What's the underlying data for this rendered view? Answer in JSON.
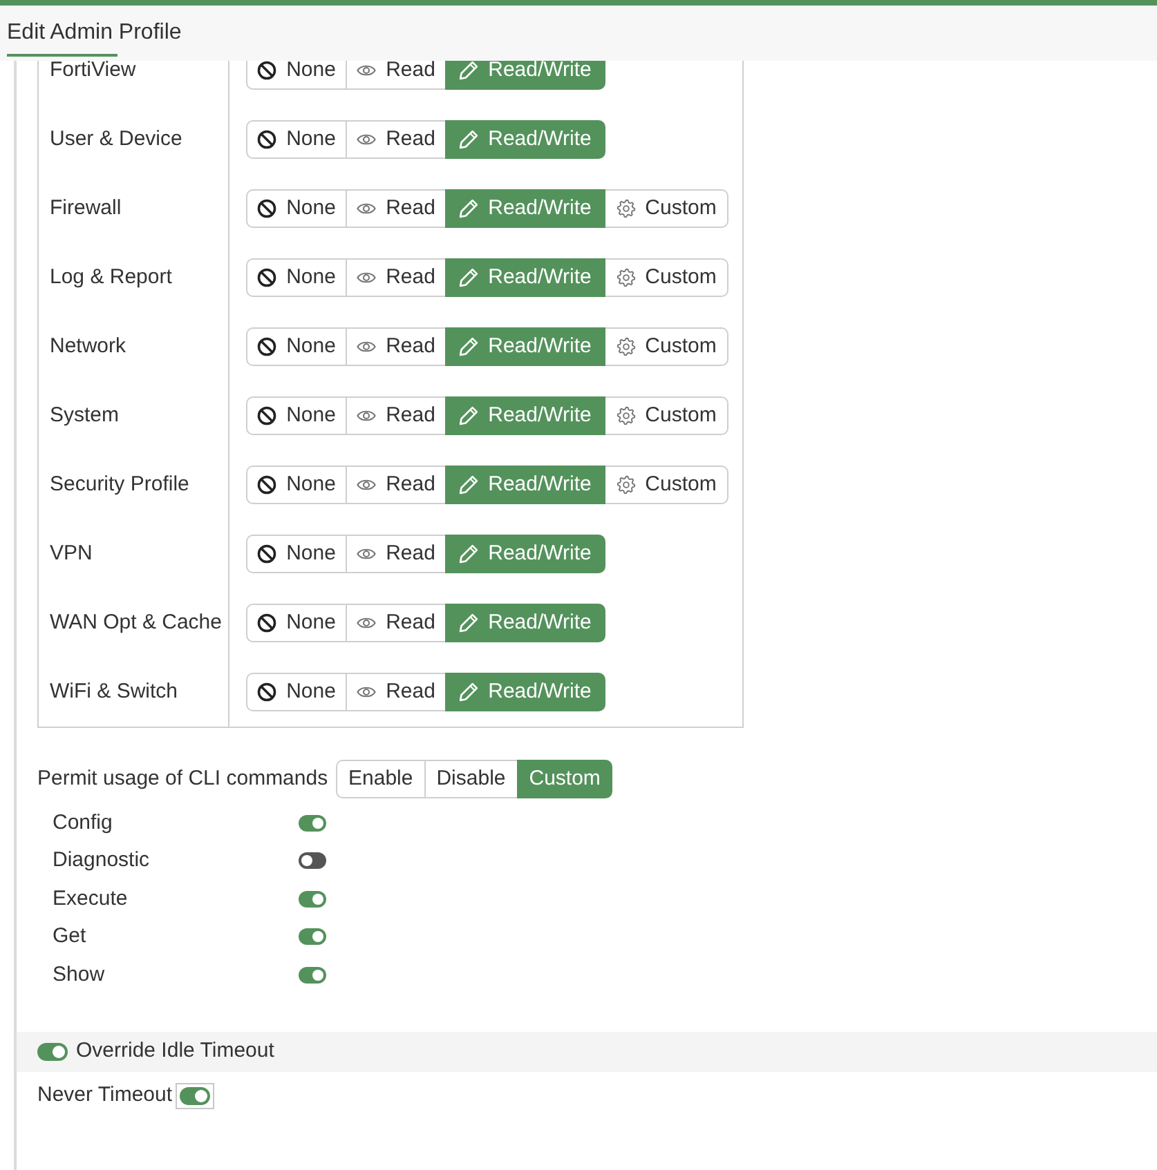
{
  "header": {
    "title": "Edit Admin Profile"
  },
  "permissions": {
    "rows": [
      {
        "label": "FortiView",
        "options": [
          {
            "kind": "none",
            "label": "None",
            "selected": false
          },
          {
            "kind": "read",
            "label": "Read",
            "selected": false
          },
          {
            "kind": "read_write",
            "label": "Read/Write",
            "selected": true
          }
        ]
      },
      {
        "label": "User & Device",
        "options": [
          {
            "kind": "none",
            "label": "None",
            "selected": false
          },
          {
            "kind": "read",
            "label": "Read",
            "selected": false
          },
          {
            "kind": "read_write",
            "label": "Read/Write",
            "selected": true
          }
        ]
      },
      {
        "label": "Firewall",
        "options": [
          {
            "kind": "none",
            "label": "None",
            "selected": false
          },
          {
            "kind": "read",
            "label": "Read",
            "selected": false
          },
          {
            "kind": "read_write",
            "label": "Read/Write",
            "selected": true
          },
          {
            "kind": "custom",
            "label": "Custom",
            "selected": false
          }
        ]
      },
      {
        "label": "Log & Report",
        "options": [
          {
            "kind": "none",
            "label": "None",
            "selected": false
          },
          {
            "kind": "read",
            "label": "Read",
            "selected": false
          },
          {
            "kind": "read_write",
            "label": "Read/Write",
            "selected": true
          },
          {
            "kind": "custom",
            "label": "Custom",
            "selected": false
          }
        ]
      },
      {
        "label": "Network",
        "options": [
          {
            "kind": "none",
            "label": "None",
            "selected": false
          },
          {
            "kind": "read",
            "label": "Read",
            "selected": false
          },
          {
            "kind": "read_write",
            "label": "Read/Write",
            "selected": true
          },
          {
            "kind": "custom",
            "label": "Custom",
            "selected": false
          }
        ]
      },
      {
        "label": "System",
        "options": [
          {
            "kind": "none",
            "label": "None",
            "selected": false
          },
          {
            "kind": "read",
            "label": "Read",
            "selected": false
          },
          {
            "kind": "read_write",
            "label": "Read/Write",
            "selected": true
          },
          {
            "kind": "custom",
            "label": "Custom",
            "selected": false
          }
        ]
      },
      {
        "label": "Security Profile",
        "options": [
          {
            "kind": "none",
            "label": "None",
            "selected": false
          },
          {
            "kind": "read",
            "label": "Read",
            "selected": false
          },
          {
            "kind": "read_write",
            "label": "Read/Write",
            "selected": true
          },
          {
            "kind": "custom",
            "label": "Custom",
            "selected": false
          }
        ]
      },
      {
        "label": "VPN",
        "options": [
          {
            "kind": "none",
            "label": "None",
            "selected": false
          },
          {
            "kind": "read",
            "label": "Read",
            "selected": false
          },
          {
            "kind": "read_write",
            "label": "Read/Write",
            "selected": true
          }
        ]
      },
      {
        "label": "WAN Opt & Cache",
        "options": [
          {
            "kind": "none",
            "label": "None",
            "selected": false
          },
          {
            "kind": "read",
            "label": "Read",
            "selected": false
          },
          {
            "kind": "read_write",
            "label": "Read/Write",
            "selected": true
          }
        ]
      },
      {
        "label": "WiFi & Switch",
        "options": [
          {
            "kind": "none",
            "label": "None",
            "selected": false
          },
          {
            "kind": "read",
            "label": "Read",
            "selected": false
          },
          {
            "kind": "read_write",
            "label": "Read/Write",
            "selected": true
          }
        ]
      }
    ]
  },
  "cli": {
    "label": "Permit usage of CLI commands",
    "options": [
      {
        "label": "Enable",
        "selected": false
      },
      {
        "label": "Disable",
        "selected": false
      },
      {
        "label": "Custom",
        "selected": true
      }
    ],
    "commands": [
      {
        "label": "Config",
        "on": true
      },
      {
        "label": "Diagnostic",
        "on": false
      },
      {
        "label": "Execute",
        "on": true
      },
      {
        "label": "Get",
        "on": true
      },
      {
        "label": "Show",
        "on": true
      }
    ]
  },
  "idle_timeout": {
    "label": "Override Idle Timeout",
    "on": true
  },
  "never_timeout": {
    "label": "Never Timeout",
    "on": true
  }
}
